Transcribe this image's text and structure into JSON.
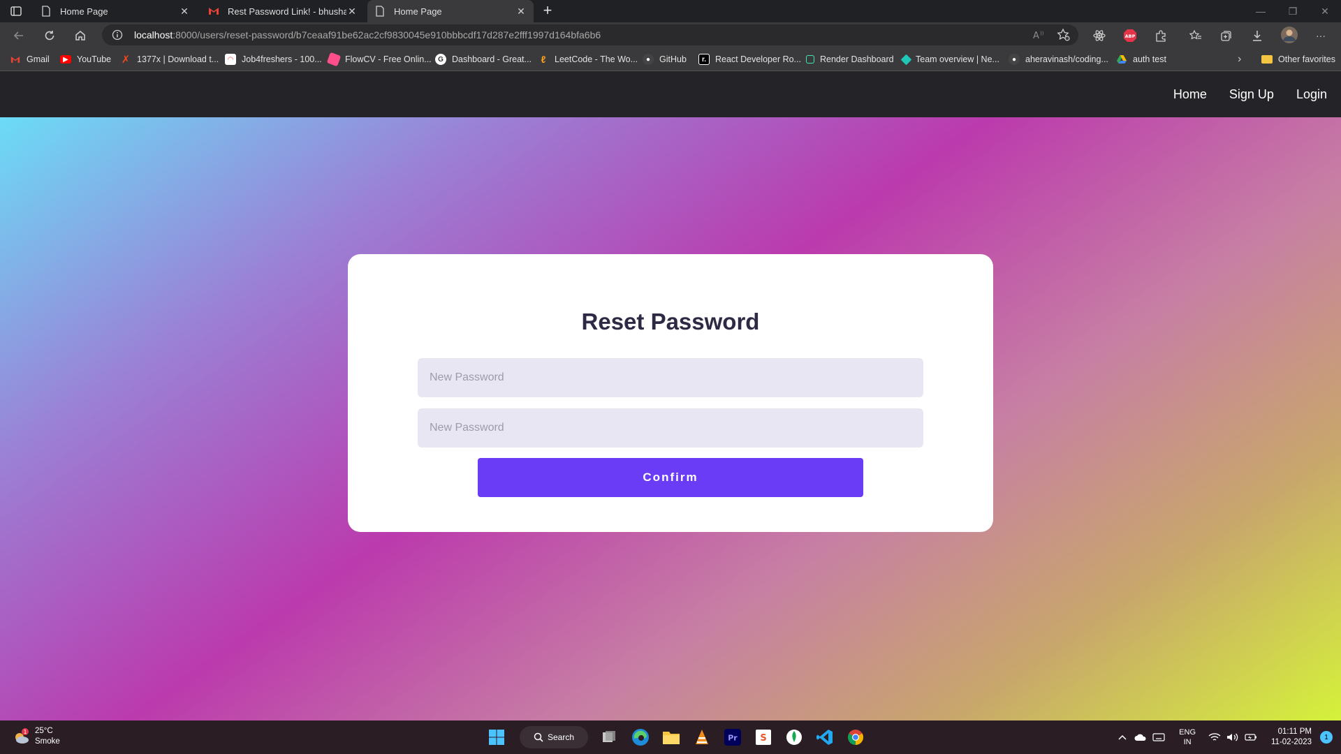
{
  "browser": {
    "tabs": [
      {
        "title": "Home Page",
        "icon": "page-icon",
        "active": false
      },
      {
        "title": "Rest Password Link! - bhushanba",
        "icon": "gmail-icon",
        "active": false
      },
      {
        "title": "Home Page",
        "icon": "page-icon",
        "active": true
      }
    ],
    "address": {
      "host": "localhost",
      "path": ":8000/users/reset-password/b7ceaaf91be62ac2cf9830045e910bbbcdf17d287e2fff1997d164bfa6b6"
    },
    "bookmarks": [
      {
        "label": "Gmail",
        "icon": "gmail-icon",
        "color": "#ea4335"
      },
      {
        "label": "YouTube",
        "icon": "youtube-icon",
        "color": "#ff0000"
      },
      {
        "label": "1377x | Download t...",
        "icon": "x-icon",
        "color": "#e94b1d"
      },
      {
        "label": "Job4freshers - 100...",
        "icon": "job-icon",
        "color": "#e34a4a"
      },
      {
        "label": "FlowCV - Free Onlin...",
        "icon": "flowcv-icon",
        "color": "#ff4f8b"
      },
      {
        "label": "Dashboard - Great...",
        "icon": "google-icon",
        "color": "#ffffff"
      },
      {
        "label": "LeetCode - The Wo...",
        "icon": "leetcode-icon",
        "color": "#f89f1b"
      },
      {
        "label": "GitHub",
        "icon": "github-icon",
        "color": "#555555"
      },
      {
        "label": "React Developer Ro...",
        "icon": "roadmap-icon",
        "color": "#000000"
      },
      {
        "label": "Render Dashboard",
        "icon": "render-icon",
        "color": "#46e3b7"
      },
      {
        "label": "Team overview | Ne...",
        "icon": "netlify-icon",
        "color": "#20c6b7"
      },
      {
        "label": "aheravinash/coding...",
        "icon": "github-icon",
        "color": "#555555"
      },
      {
        "label": "auth test",
        "icon": "drive-icon",
        "color": "#fbbc04"
      }
    ],
    "other_favorites": "Other favorites"
  },
  "site": {
    "nav": [
      {
        "label": "Home"
      },
      {
        "label": "Sign Up"
      },
      {
        "label": "Login"
      }
    ]
  },
  "form": {
    "title": "Reset Password",
    "new_password_placeholder": "New Password",
    "confirm_password_placeholder": "New Password",
    "submit_label": "Confirm"
  },
  "taskbar": {
    "weather": {
      "temp": "25°C",
      "condition": "Smoke",
      "badge": "1"
    },
    "search_label": "Search",
    "language": {
      "line1": "ENG",
      "line2": "IN"
    },
    "clock": {
      "time": "01:11 PM",
      "date": "11-02-2023"
    },
    "notification_count": "1"
  },
  "colors": {
    "accent": "#6a3cf5",
    "title": "#2e2944",
    "input_bg": "#e8e6f2",
    "header_bg": "#242428"
  }
}
